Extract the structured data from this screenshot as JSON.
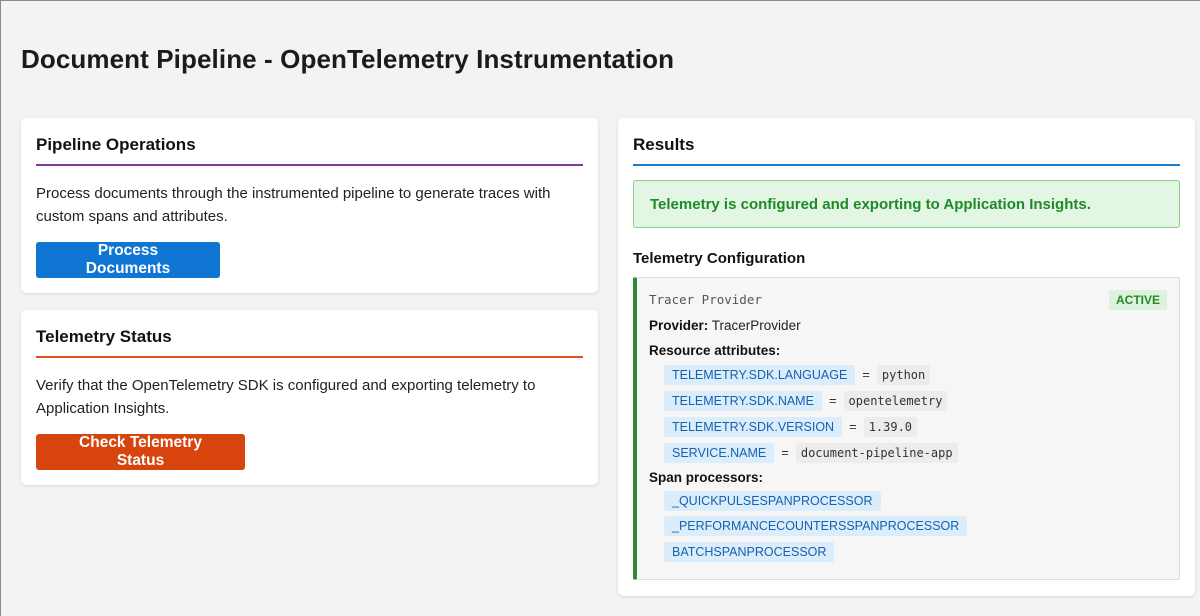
{
  "page": {
    "title": "Document Pipeline - OpenTelemetry Instrumentation"
  },
  "operations": {
    "heading": "Pipeline Operations",
    "description": "Process documents through the instrumented pipeline to generate traces with custom spans and attributes.",
    "button_label": "Process Documents"
  },
  "status": {
    "heading": "Telemetry Status",
    "description": "Verify that the OpenTelemetry SDK is configured and exporting telemetry to Application Insights.",
    "button_label": "Check Telemetry Status"
  },
  "results": {
    "heading": "Results",
    "success_message": "Telemetry is configured and exporting to Application Insights.",
    "config_heading": "Telemetry Configuration",
    "tracer_label": "Tracer Provider",
    "badge": "ACTIVE",
    "provider_label": "Provider:",
    "provider_value": "TracerProvider",
    "resource_attributes_label": "Resource attributes:",
    "resource_attributes": [
      {
        "key": "TELEMETRY.SDK.LANGUAGE",
        "eq": "=",
        "value": "python"
      },
      {
        "key": "TELEMETRY.SDK.NAME",
        "eq": "=",
        "value": "opentelemetry"
      },
      {
        "key": "TELEMETRY.SDK.VERSION",
        "eq": "=",
        "value": "1.39.0"
      },
      {
        "key": "SERVICE.NAME",
        "eq": "=",
        "value": "document-pipeline-app"
      }
    ],
    "span_processors_label": "Span processors:",
    "span_processors": [
      "_QUICKPULSESPANPROCESSOR",
      "_PERFORMANCECOUNTERSSPANPROCESSOR",
      "BATCHSPANPROCESSOR"
    ]
  },
  "colors": {
    "primary_button": "#1076d4",
    "status_button": "#d8440d",
    "operations_accent": "#7a3b9a",
    "status_accent": "#d8531e",
    "results_accent": "#1a7fcc",
    "success_text": "#1f8a28",
    "config_border": "#2f8a33"
  }
}
